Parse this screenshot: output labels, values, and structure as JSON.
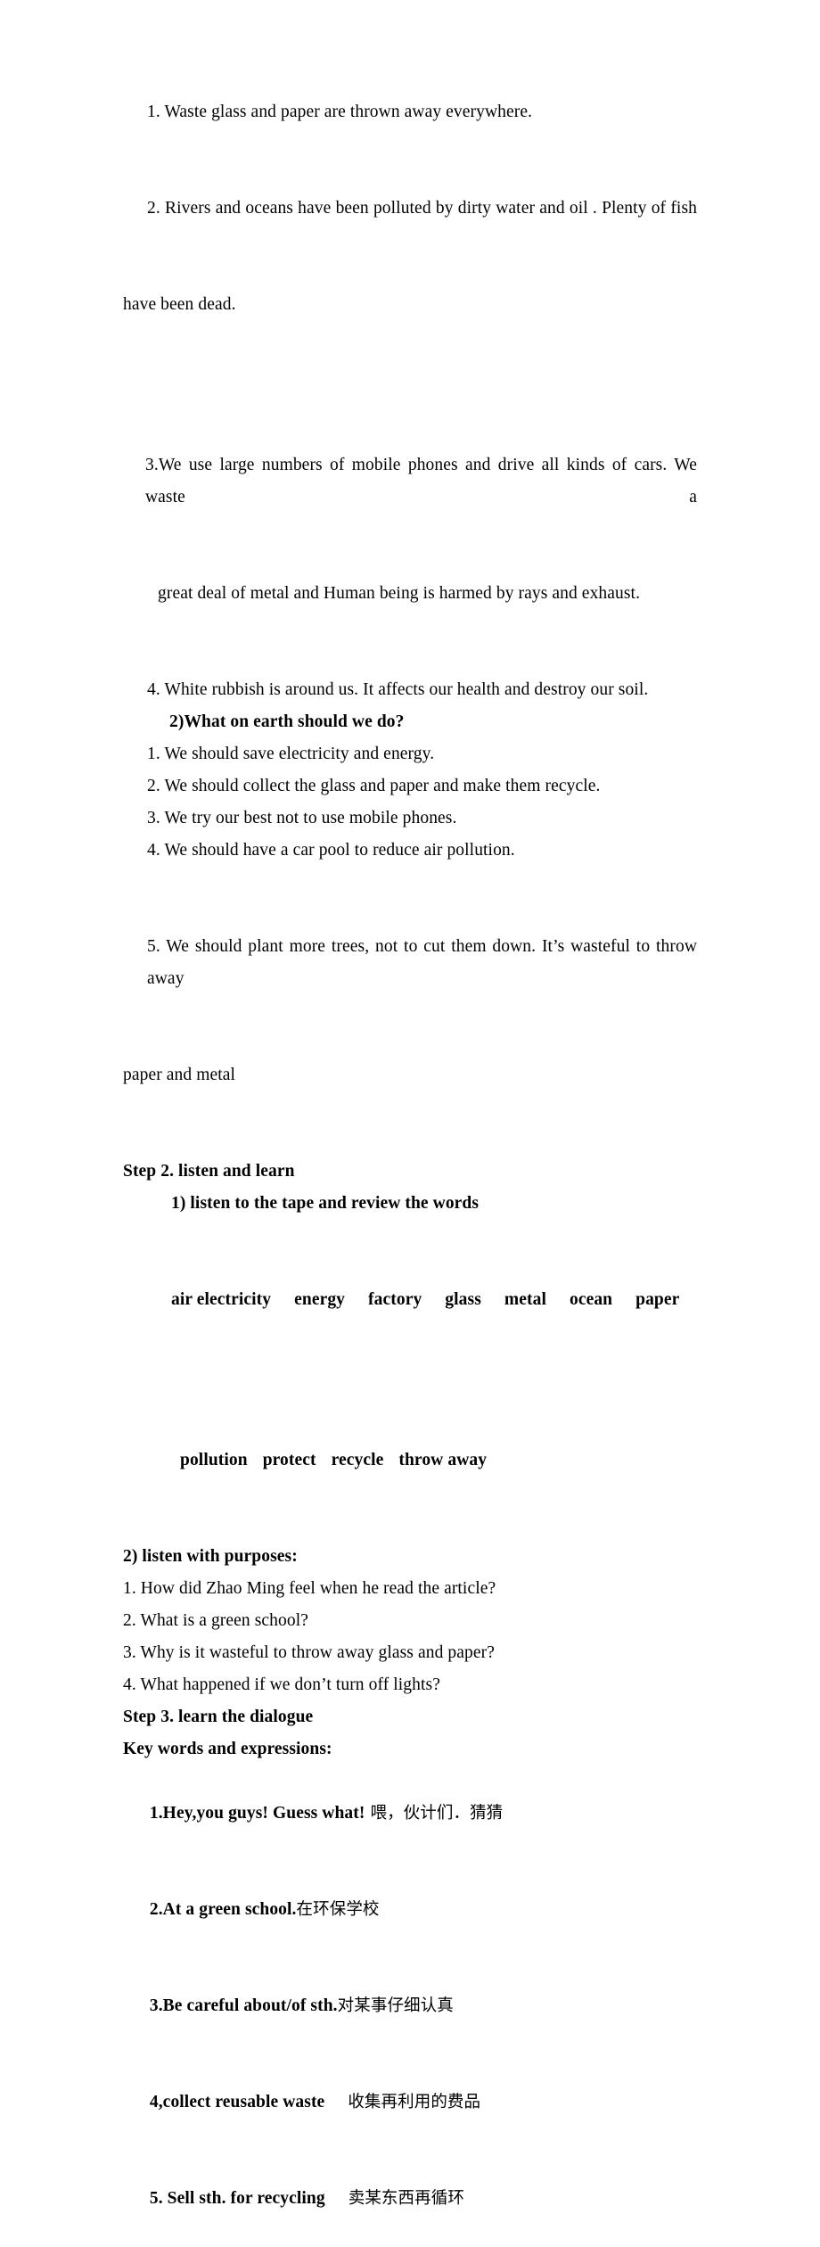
{
  "document": {
    "type": "lesson-plan-page",
    "page_background": "#ffffff",
    "text_color": "#000000",
    "problems_section": {
      "items": [
        "1. Waste glass and paper are thrown away everywhere.",
        "2. Rivers and oceans have been polluted by dirty water and oil . Plenty of fish have been dead.",
        "3.We use large numbers of mobile phones and drive all kinds of cars. We waste a",
        "great deal of metal and Human being is harmed by rays and exhaust.",
        "4. White rubbish is around us. It affects our health and destroy our soil."
      ],
      "item2_line1": "2. Rivers and oceans have been polluted by dirty water and oil . Plenty of fish",
      "item2_line2": "have been dead."
    },
    "question_heading": "2)What on earth should we do?",
    "solutions": [
      "1. We should save electricity and energy.",
      "2. We should collect the glass and paper and make them recycle.",
      "3. We try our best not to use mobile phones.",
      "4. We should have a car pool to reduce air pollution.",
      "5. We should plant more trees, not to cut them down. It’s wasteful to throw away"
    ],
    "solution5_wrap": "paper and metal",
    "step2": {
      "heading": "Step 2. listen and learn",
      "sub_heading": "1) listen to the tape and review the words",
      "word_bank_line1": [
        "air electricity",
        "energy",
        "factory",
        "glass",
        "metal",
        "ocean",
        "paper"
      ],
      "word_bank_line2": [
        "pollution",
        "protect",
        "recycle",
        "throw away"
      ],
      "listen_heading": "2) listen with purposes:",
      "questions": [
        "1. How did Zhao Ming feel when he read the article?",
        "2. What is a green school?",
        "3. Why is it wasteful to throw away glass and paper?",
        "4. What happened if we don’t turn off lights?"
      ]
    },
    "step3": {
      "heading": "Step 3. learn the dialogue",
      "key_words_heading": "Key words and expressions:",
      "entries": [
        {
          "english": "1.Hey,you guys! Guess what!",
          "chinese": "喂，伙计们．猜猜",
          "gap": "small"
        },
        {
          "english": "2.At a green school.",
          "chinese": "在环保学校",
          "gap": "none"
        },
        {
          "english": "3.Be careful about/of sth.",
          "chinese": "对某事仔细认真",
          "gap": "none"
        },
        {
          "english": "4,collect reusable waste",
          "chinese": "收集再利用的费品",
          "gap": "large"
        },
        {
          "english": "5. Sell sth. for recycling",
          "chinese": "卖某东西再循环",
          "gap": "large"
        }
      ]
    }
  }
}
